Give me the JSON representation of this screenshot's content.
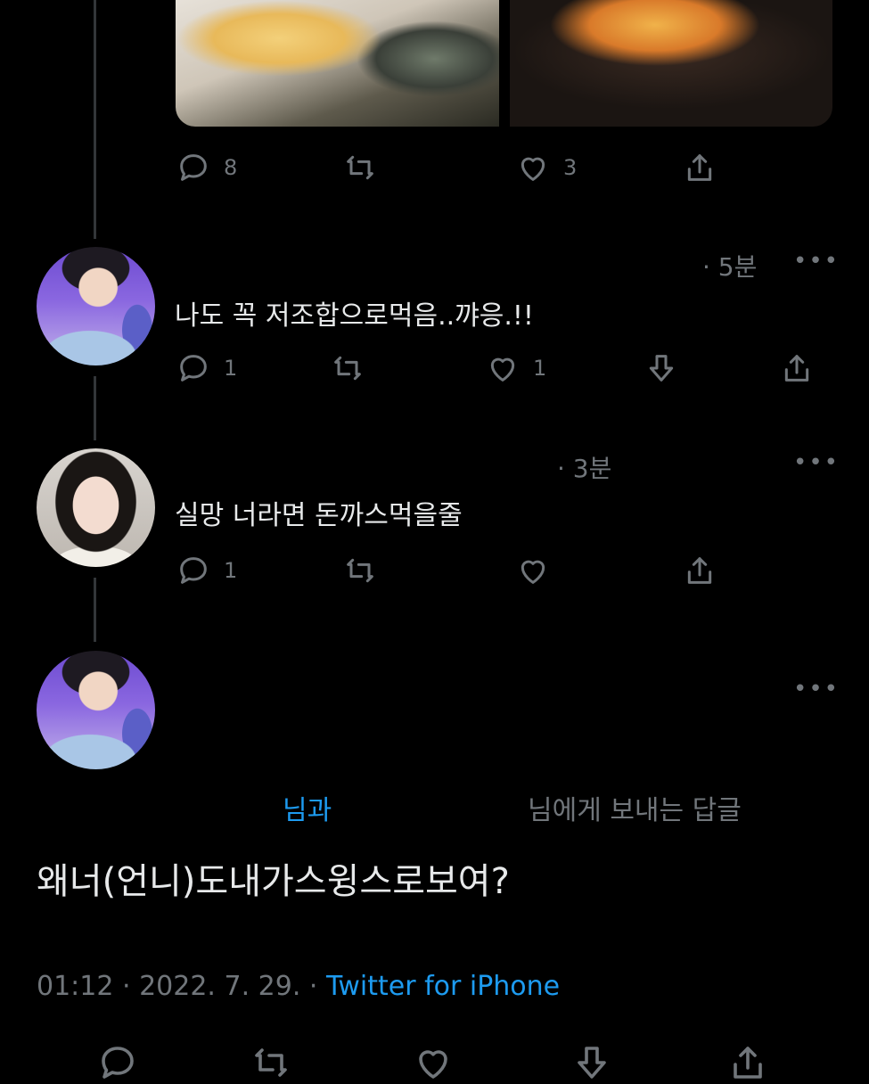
{
  "colors": {
    "background": "#000000",
    "text": "#e7e9ea",
    "muted": "#71767b",
    "accent": "#1d9bf0",
    "thread_line": "#333639"
  },
  "original_tweet": {
    "media": [
      {
        "name": "cheese-fries-photo"
      },
      {
        "name": "tteokbokki-stew-photo"
      }
    ],
    "actions": {
      "reply_count": "8",
      "retweet_count": "",
      "like_count": "3"
    }
  },
  "reply1": {
    "time": "· 5분",
    "text": "나도 꼭 저조합으로먹음..꺄응.!!",
    "actions": {
      "reply_count": "1",
      "retweet_count": "",
      "like_count": "1"
    }
  },
  "reply2": {
    "time": "· 3분",
    "text": "실망 너라면 돈까스먹을줄",
    "actions": {
      "reply_count": "1",
      "retweet_count": "",
      "like_count": ""
    }
  },
  "main_tweet": {
    "reply_to_prefix": "님과",
    "reply_to_suffix": "님에게 보내는 답글",
    "text": "왜너(언니)도내가스윙스로보여?",
    "timestamp": "01:12 · 2022. 7. 29. ·",
    "source": "Twitter for iPhone"
  },
  "icons": [
    "reply-icon",
    "retweet-icon",
    "like-icon",
    "downvote-icon",
    "share-icon",
    "more-icon"
  ]
}
